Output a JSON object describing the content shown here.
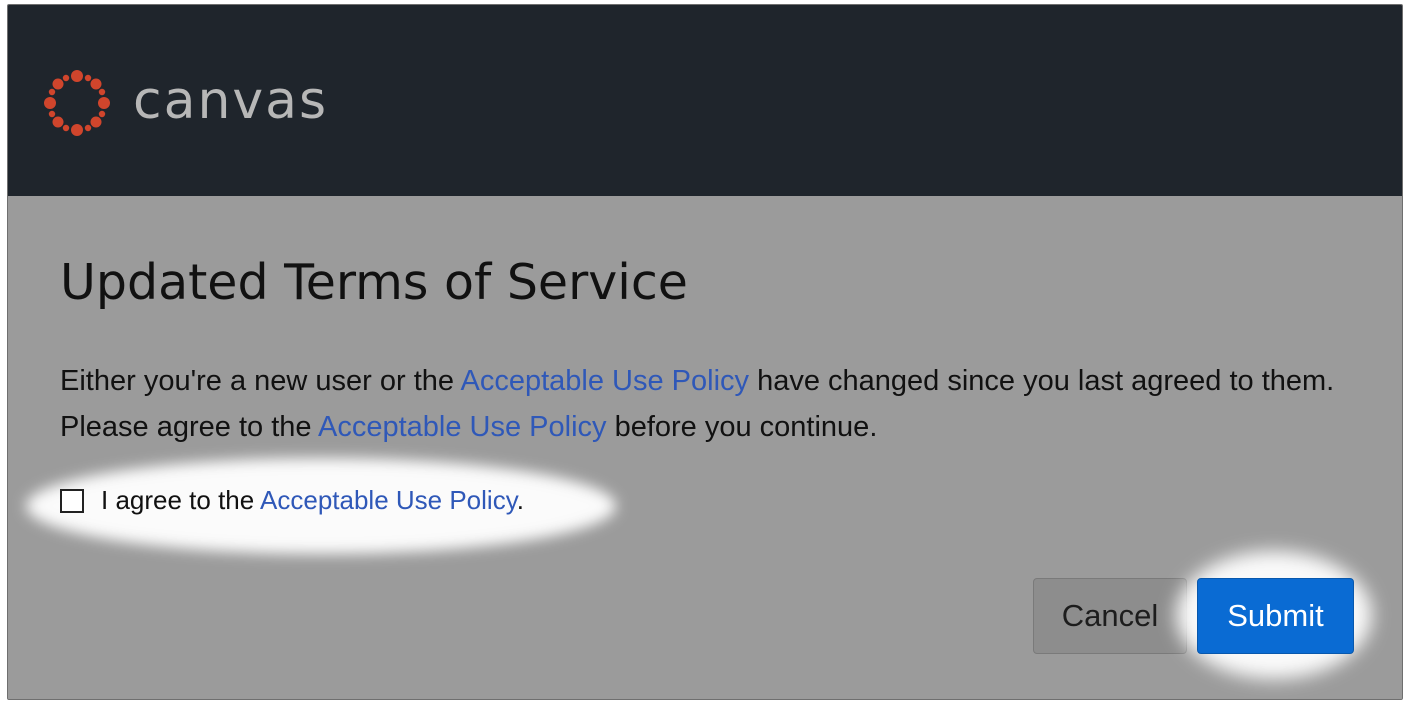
{
  "brand": {
    "name": "canvas",
    "logo_icon": "canvas-logo-icon",
    "logo_color": "#d0452c",
    "header_background": "#1f252c"
  },
  "dialog": {
    "title": "Updated Terms of Service",
    "message": {
      "part_1": "Either you're a new user or the ",
      "link_1": "Acceptable Use Policy",
      "part_2": " have changed since you last agreed to them. Please agree to the ",
      "link_2": "Acceptable Use Policy",
      "part_3": " before you continue."
    },
    "agreement": {
      "prefix": "I agree to the ",
      "link": "Acceptable Use Policy",
      "suffix": ".",
      "checked": false
    },
    "buttons": {
      "cancel_label": "Cancel",
      "submit_label": "Submit"
    },
    "colors": {
      "link": "#2f58b8",
      "submit": "#0a6bd3",
      "overlay_background": "#9b9b9b"
    }
  }
}
